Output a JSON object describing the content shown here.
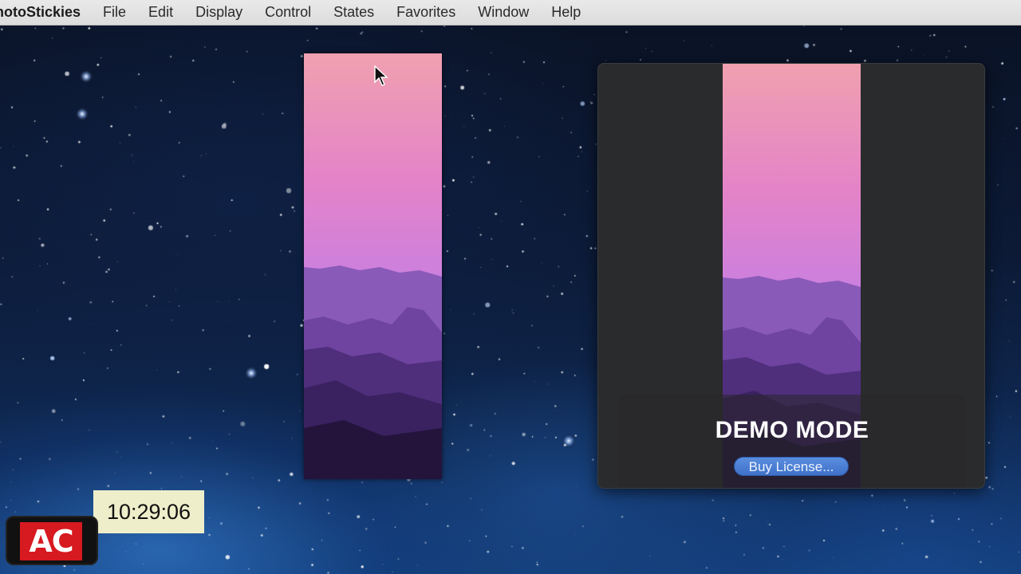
{
  "menubar": {
    "app_name": "hotoStickies",
    "items": [
      "File",
      "Edit",
      "Display",
      "Control",
      "States",
      "Favorites",
      "Window",
      "Help"
    ]
  },
  "demo_window": {
    "title": "DEMO MODE",
    "buy_label": "Buy License..."
  },
  "clock": {
    "time": "10:29:06"
  },
  "logo": {
    "text": "AC"
  },
  "colors": {
    "sky_top": "#f0a0b0",
    "sky_mid": "#e07cd0",
    "sky_low": "#b27ae0",
    "mountain_far": "#8a5ab8",
    "mountain_mid": "#5e3a8c",
    "mountain_near": "#2e1a4a",
    "button_blue": "#4a7fd6",
    "clock_bg": "#eeeeca",
    "logo_red": "#d71920"
  },
  "icons": {
    "cursor": "arrow-cursor-icon"
  }
}
